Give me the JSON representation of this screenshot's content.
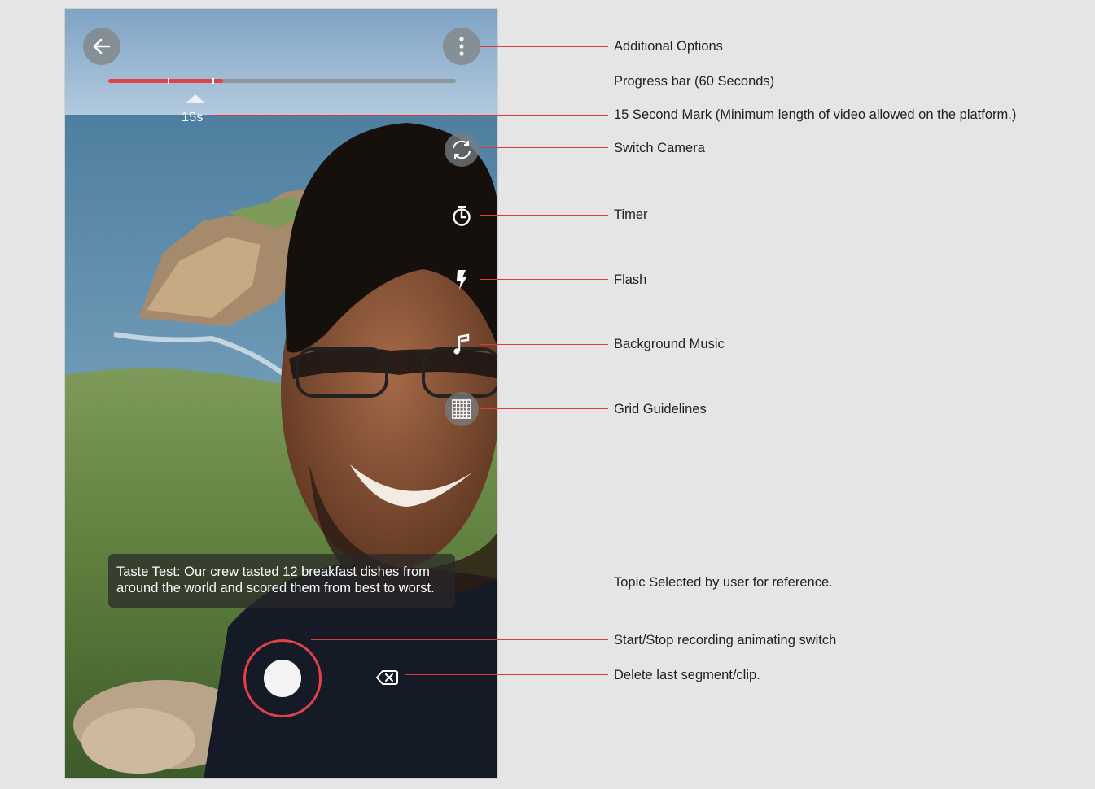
{
  "camera": {
    "mark_label": "15s",
    "progress_fraction": 0.33,
    "tick_fractions": [
      0.17,
      0.3
    ],
    "topic_text": "Taste Test: Our crew tasted 12 breakfast dishes from around the world and scored them from best to worst."
  },
  "icons": {
    "back": "arrow-left-icon",
    "more": "more-vertical-icon",
    "switch_camera": "switch-camera-icon",
    "timer": "timer-icon",
    "flash": "flash-icon",
    "music": "music-note-icon",
    "grid": "grid-icon",
    "record": "record-icon",
    "delete": "backspace-icon"
  },
  "annotations": [
    {
      "id": "additional-options",
      "label": "Additional Options"
    },
    {
      "id": "progress-bar",
      "label": "Progress bar (60 Seconds)"
    },
    {
      "id": "fifteen-second-mark",
      "label": "15 Second Mark (Minimum length of video allowed on the platform.)"
    },
    {
      "id": "switch-camera",
      "label": "Switch Camera"
    },
    {
      "id": "timer",
      "label": "Timer"
    },
    {
      "id": "flash",
      "label": "Flash"
    },
    {
      "id": "background-music",
      "label": "Background Music"
    },
    {
      "id": "grid-guidelines",
      "label": "Grid Guidelines"
    },
    {
      "id": "topic-selected",
      "label": "Topic Selected by user for reference."
    },
    {
      "id": "record-switch",
      "label": "Start/Stop recording animating switch"
    },
    {
      "id": "delete-segment",
      "label": "Delete last segment/clip."
    }
  ],
  "colors": {
    "accent_red": "#e2414b",
    "callout_red": "#e03a3a",
    "background": "#e5e5e5"
  }
}
